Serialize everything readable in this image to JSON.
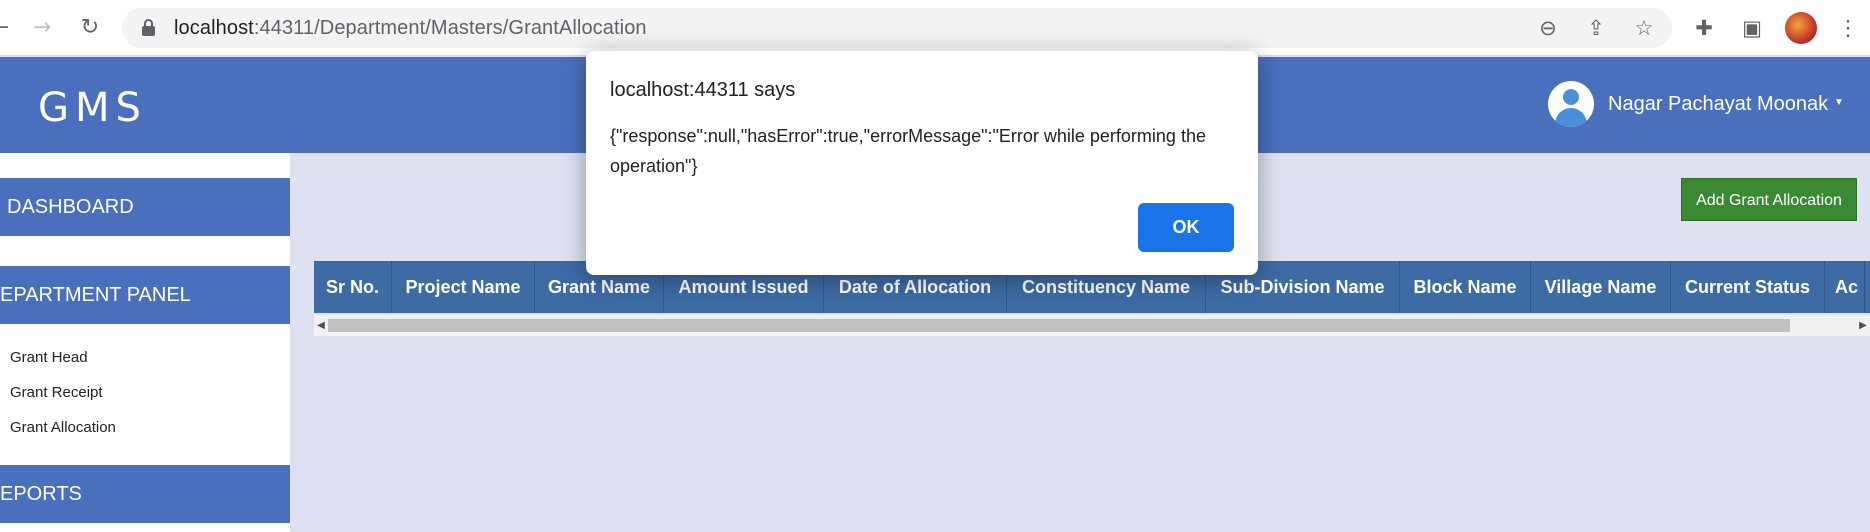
{
  "browser": {
    "url_host": "localhost",
    "url_rest": ":44311/Department/Masters/GrantAllocation"
  },
  "app": {
    "logo": "GMS",
    "user_name": "Nagar Pachayat Moonak"
  },
  "sidebar": {
    "sections": [
      {
        "label": "DASHBOARD"
      },
      {
        "label": "EPARTMENT PANEL"
      },
      {
        "label": "EPORTS"
      }
    ],
    "items": [
      {
        "label": "Grant Head"
      },
      {
        "label": "Grant Receipt"
      },
      {
        "label": "Grant Allocation"
      }
    ]
  },
  "main": {
    "add_button": "Add Grant Allocation",
    "table": {
      "columns": [
        "Sr No.",
        "Project Name",
        "Grant Name",
        "Amount Issued",
        "Date of Allocation",
        "Constituency Name",
        "Sub-Division Name",
        "Block Name",
        "Village Name",
        "Current Status",
        "Ac"
      ]
    }
  },
  "dialog": {
    "title": "localhost:44311 says",
    "message": "{\"response\":null,\"hasError\":true,\"errorMessage\":\"Error while performing the operation\"}",
    "ok_label": "OK"
  },
  "colors": {
    "header_blue": "#4a6fbd",
    "table_header": "#3d6ba4",
    "add_button_green": "#3a8a35",
    "ok_button_blue": "#1a73e8",
    "content_bg": "#dde1f2"
  }
}
